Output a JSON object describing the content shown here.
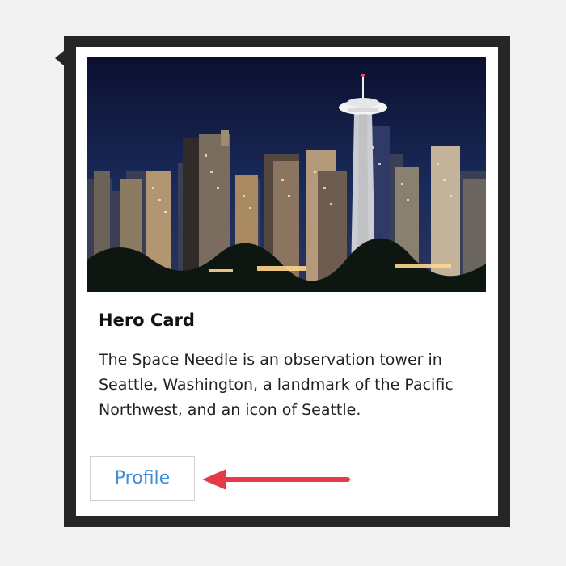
{
  "card": {
    "title": "Hero Card",
    "text": "The Space Needle is an observation tower in Seattle, Washington, a landmark of the Pacific Northwest, and an icon of Seattle.",
    "button_label": "Profile"
  },
  "image": {
    "subject": "seattle-skyline-night-space-needle"
  },
  "annotation": {
    "arrow_color": "#e8394a",
    "points_to": "profile-button"
  },
  "colors": {
    "button_text": "#3d8fd6",
    "frame": "#262626"
  }
}
